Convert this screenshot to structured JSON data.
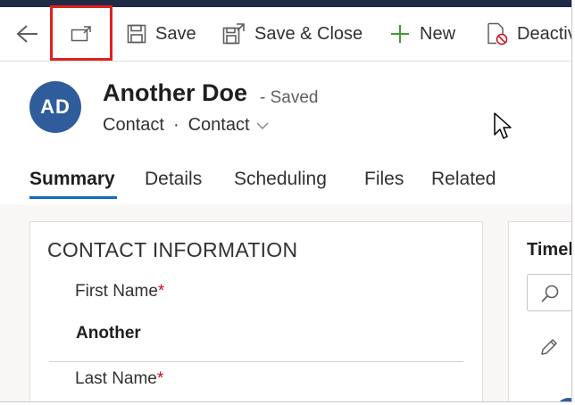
{
  "command_bar": {
    "back": {
      "icon": "back-arrow-icon"
    },
    "popout": {
      "icon": "open-in-new-window-icon"
    },
    "save": {
      "label": "Save",
      "icon": "save-icon"
    },
    "save_close": {
      "label": "Save & Close",
      "icon": "save-and-close-icon"
    },
    "new": {
      "label": "New",
      "icon": "plus-icon"
    },
    "deactivate": {
      "label": "Deactiv",
      "icon": "deactivate-icon"
    }
  },
  "record": {
    "initials": "AD",
    "name": "Another Doe",
    "status": "- Saved",
    "entity_type": "Contact",
    "separator": "·",
    "form_selector": "Contact"
  },
  "tabs": [
    {
      "label": "Summary",
      "active": true
    },
    {
      "label": "Details",
      "active": false
    },
    {
      "label": "Scheduling",
      "active": false
    },
    {
      "label": "Files",
      "active": false
    },
    {
      "label": "Related",
      "active": false
    }
  ],
  "contact_section": {
    "title": "CONTACT INFORMATION",
    "fields": [
      {
        "label": "First Name",
        "required_mark": "*",
        "value": "Another"
      },
      {
        "label": "Last Name",
        "required_mark": "*",
        "value": ""
      }
    ]
  },
  "timeline": {
    "title": "Timel"
  },
  "colors": {
    "accent": "#0f6cbd",
    "avatar": "#2f5d9c",
    "required": "#c50f1f",
    "highlight_box": "#e02020",
    "new_icon": "#3a9a3a"
  }
}
